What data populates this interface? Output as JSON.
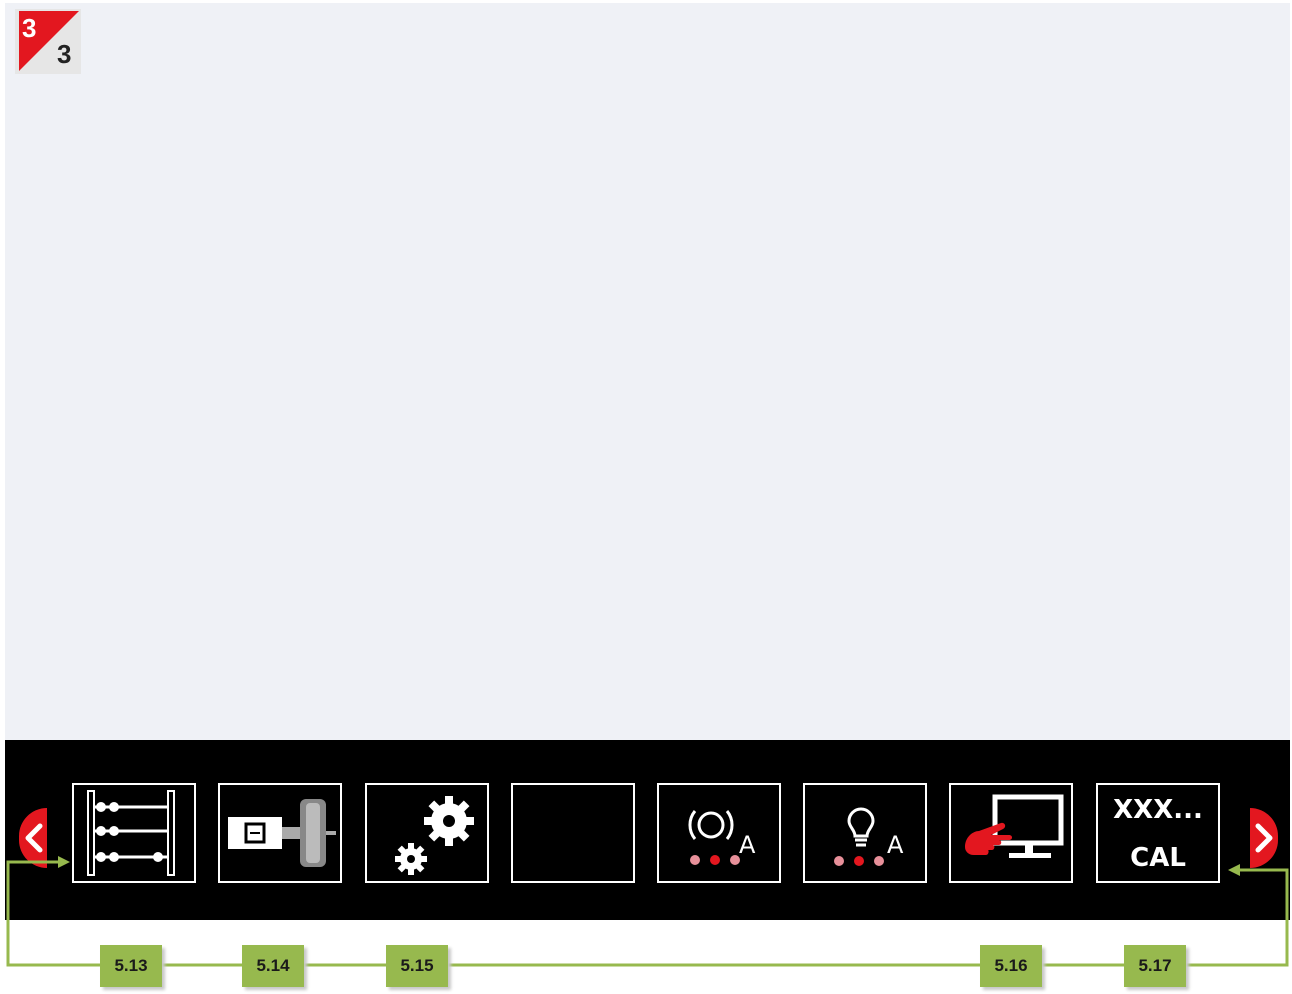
{
  "screen": {
    "background": "#eff1f6",
    "page_indicator": {
      "current": "3",
      "total": "3",
      "accent": "#e3171f"
    }
  },
  "toolbar": {
    "prev_icon": "chevron-left-icon",
    "next_icon": "chevron-right-icon",
    "buttons": [
      {
        "icon": "abacus-icon"
      },
      {
        "icon": "wheel-balancer-icon"
      },
      {
        "icon": "gears-icon"
      },
      {
        "icon": "blank-icon"
      },
      {
        "icon": "brake-warning-icon",
        "suffix": "A"
      },
      {
        "icon": "bulb-warning-icon",
        "suffix": "A"
      },
      {
        "icon": "touch-screen-icon"
      },
      {
        "top": "XXX...",
        "bottom": "CAL"
      }
    ]
  },
  "callout_labels": [
    "5.13",
    "5.14",
    "5.15",
    "5.16",
    "5.17"
  ],
  "callout_color": "#97b94e"
}
